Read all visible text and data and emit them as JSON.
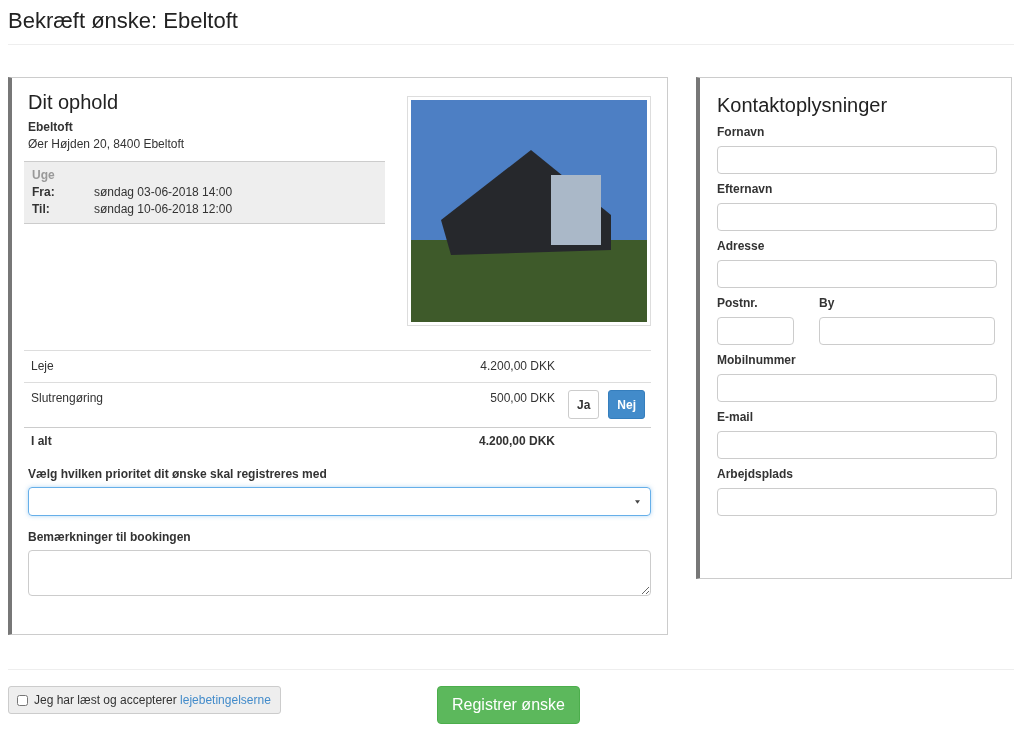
{
  "page_title": "Bekræft ønske: Ebeltoft",
  "stay": {
    "heading": "Dit ophold",
    "name": "Ebeltoft",
    "address": "Øer Højden 20, 8400 Ebeltoft",
    "period": {
      "type": "Uge",
      "rows": [
        {
          "label": "Fra:",
          "value": "søndag 03-06-2018 14:00"
        },
        {
          "label": "Til:",
          "value": "søndag 10-06-2018 12:00"
        }
      ]
    },
    "prices": [
      {
        "kind": "line",
        "label": "Leje",
        "amount": "4.200,00 DKK"
      },
      {
        "kind": "toggle",
        "label": "Slutrengøring",
        "amount": "500,00 DKK",
        "options": [
          {
            "label": "Ja",
            "selected": false
          },
          {
            "label": "Nej",
            "selected": true
          }
        ]
      },
      {
        "kind": "total",
        "label": "I alt",
        "amount": "4.200,00 DKK"
      }
    ],
    "priority_label": "Vælg hvilken prioritet dit ønske skal registreres med",
    "remarks_label": "Bemærkninger til bookingen"
  },
  "contact": {
    "heading": "Kontaktoplysninger",
    "rows": [
      [
        {
          "label": "Fornavn"
        }
      ],
      [
        {
          "label": "Efternavn"
        }
      ],
      [
        {
          "label": "Adresse"
        }
      ],
      [
        {
          "label": "Postnr."
        },
        {
          "label": "By"
        }
      ],
      [
        {
          "label": "Mobilnummer"
        }
      ],
      [
        {
          "label": "E-mail"
        }
      ],
      [
        {
          "label": "Arbejdsplads"
        }
      ]
    ]
  },
  "terms": {
    "checked": false,
    "text": "Jeg har læst og accepterer ",
    "link": "lejebetingelserne"
  },
  "submit": "Registrer ønske"
}
